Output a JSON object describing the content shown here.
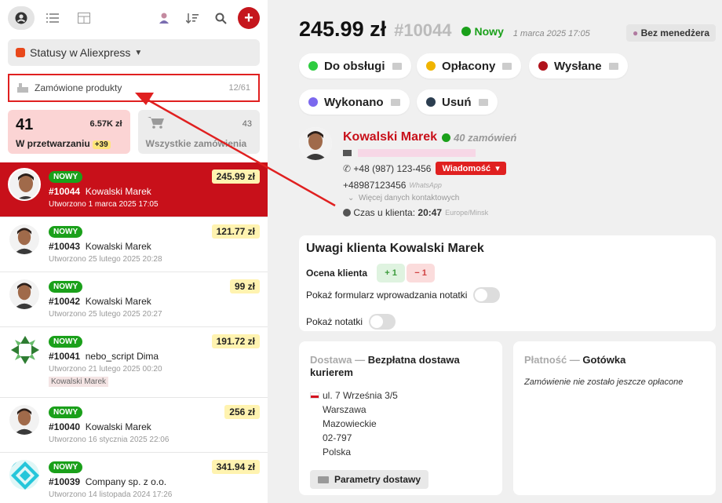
{
  "toolbar": {
    "icons": [
      "user-icon",
      "list-icon",
      "table-icon",
      "manager-icon",
      "sort-icon",
      "search-icon",
      "add-icon"
    ]
  },
  "status_filter": {
    "label": "Statusy w Aliexpress"
  },
  "products": {
    "label": "Zamówione produkty",
    "count": "12/61"
  },
  "tiles": {
    "processing": {
      "count": "41",
      "amount": "6.57K zł",
      "label": "W przetwarzaniu",
      "badge": "+39"
    },
    "all": {
      "count": "43",
      "label": "Wszystkie zamówienia"
    }
  },
  "orders": [
    {
      "status": "NOWY",
      "price": "245.99 zł",
      "number": "#10044",
      "customer": "Kowalski Marek",
      "created": "Utworzono 1 marca 2025 17:05",
      "tag": ""
    },
    {
      "status": "NOWY",
      "price": "121.77 zł",
      "number": "#10043",
      "customer": "Kowalski Marek",
      "created": "Utworzono 25 lutego 2025 20:28",
      "tag": ""
    },
    {
      "status": "NOWY",
      "price": "99 zł",
      "number": "#10042",
      "customer": "Kowalski Marek",
      "created": "Utworzono 25 lutego 2025 20:27",
      "tag": ""
    },
    {
      "status": "NOWY",
      "price": "191.72 zł",
      "number": "#10041",
      "customer": "nebo_script Dima",
      "created": "Utworzono 21 lutego 2025 00:20",
      "tag": "Kowalski Marek"
    },
    {
      "status": "NOWY",
      "price": "256 zł",
      "number": "#10040",
      "customer": "Kowalski Marek",
      "created": "Utworzono 16 stycznia 2025 22:06",
      "tag": ""
    },
    {
      "status": "NOWY",
      "price": "341.94 zł",
      "number": "#10039",
      "customer": "Company sp. z o.o.",
      "created": "Utworzono 14 listopada 2024 17:26",
      "tag": ""
    }
  ],
  "detail": {
    "total": "245.99 zł",
    "number": "#10044",
    "status": "Nowy",
    "date": "1 marca 2025 17:05",
    "manager_button": "Bez menedżera"
  },
  "status_pills": [
    {
      "label": "Do obsługi",
      "color": "#2ecc40"
    },
    {
      "label": "Opłacony",
      "color": "#f0b400"
    },
    {
      "label": "Wysłane",
      "color": "#b0121b"
    },
    {
      "label": "Wykonano",
      "color": "#7b68ee"
    },
    {
      "label": "Usuń",
      "color": "#2c3e50"
    }
  ],
  "customer": {
    "name": "Kowalski Marek",
    "orders": "40 zamówień",
    "phone": "+48 (987) 123-456",
    "message_button": "Wiadomość",
    "whatsapp_number": "+48987123456",
    "whatsapp_label": "WhatsApp",
    "more": "Więcej danych kontaktowych",
    "time_label": "Czas u klienta:",
    "time": "20:47",
    "timezone": "Europe/Minsk"
  },
  "notes": {
    "title": "Uwagi klienta Kowalski Marek",
    "rating_label": "Ocena klienta",
    "rating_plus": "+ 1",
    "rating_minus": "− 1",
    "toggle_form": "Pokaż formularz wprowadzania notatki",
    "toggle_notes": "Pokaż notatki"
  },
  "delivery": {
    "label": "Dostawa —",
    "method": "Bezpłatna dostawa kurierem",
    "street": "ul. 7 Września 3/5",
    "city": "Warszawa",
    "region": "Mazowieckie",
    "zip": "02-797",
    "country": "Polska",
    "params_button": "Parametry dostawy"
  },
  "payment": {
    "label": "Płatność —",
    "method": "Gotówka",
    "note": "Zamówienie nie zostało jeszcze opłacone"
  },
  "colors": {
    "accent": "#c8101a",
    "new": "#1aa01a",
    "annotation": "#e02020"
  }
}
